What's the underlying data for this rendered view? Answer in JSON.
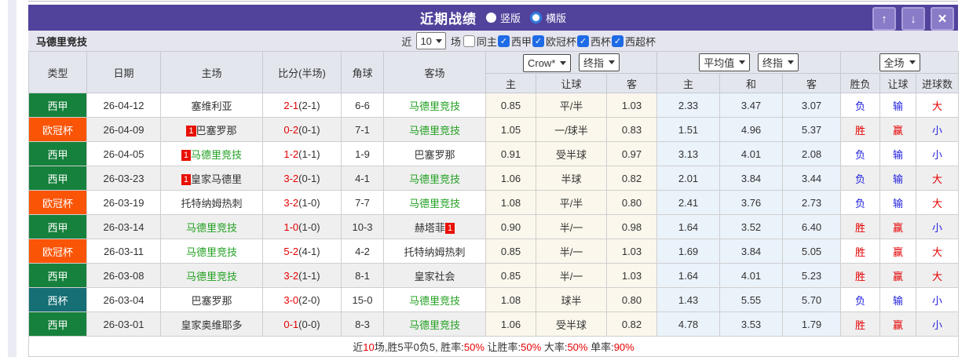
{
  "titlebar": {
    "title": "近期战绩",
    "radios": [
      {
        "label": "竖版",
        "selected": true
      },
      {
        "label": "横版",
        "selected": false
      }
    ],
    "buttons": [
      {
        "name": "move-up",
        "glyph": "↑"
      },
      {
        "name": "move-down",
        "glyph": "↓"
      },
      {
        "name": "close",
        "glyph": "×"
      }
    ]
  },
  "subheader": {
    "team": "马德里竞技",
    "near_label": "近",
    "count": "10",
    "unit": "场",
    "checkboxes": [
      {
        "label": "同主",
        "checked": false
      },
      {
        "label": "西甲",
        "checked": true
      },
      {
        "label": "欧冠杯",
        "checked": true
      },
      {
        "label": "西杯",
        "checked": true
      },
      {
        "label": "西超杯",
        "checked": true
      }
    ]
  },
  "colors": {
    "titlebar_purple": "#51429b",
    "laliga_green": "#16813c",
    "ucl_orange": "#fa5407",
    "copa_teal": "#156f75",
    "team_green": "#22a022",
    "win_red": "#e60000",
    "lose_blue": "#2121e0",
    "checkbox_blue": "#1f6be6",
    "crow_col_bg": "#fbf7ec",
    "avg_col_bg": "#eaf2fa"
  },
  "table": {
    "main_headers": [
      "类型",
      "日期",
      "主场",
      "比分(半场)",
      "角球",
      "客场"
    ],
    "group1": {
      "select1": "Crow*",
      "select2": "终指",
      "cols": [
        "主",
        "让球",
        "客"
      ]
    },
    "group2": {
      "select1": "平均值",
      "select2": "终指",
      "cols": [
        "主",
        "和",
        "客"
      ]
    },
    "group3": {
      "select": "全场",
      "cols": [
        "胜负",
        "让球",
        "进球数"
      ]
    },
    "rows": [
      {
        "type": "西甲",
        "type_color": "#16813c",
        "date": "26-04-12",
        "home": "塞维利亚",
        "home_green": false,
        "home_mark_pre": null,
        "score": "2-1",
        "half": "(2-1)",
        "corner": "6-6",
        "away": "马德里竞技",
        "away_green": true,
        "away_mark_post": null,
        "crow": [
          "0.85",
          "平/半",
          "1.03"
        ],
        "avg": [
          "2.33",
          "3.47",
          "3.07"
        ],
        "outcome": [
          {
            "text": "负",
            "color": "blue"
          },
          {
            "text": "输",
            "color": "blue"
          },
          {
            "text": "大",
            "color": "red"
          }
        ]
      },
      {
        "type": "欧冠杯",
        "type_color": "#fa5407",
        "date": "26-04-09",
        "home": "巴塞罗那",
        "home_green": false,
        "home_mark_pre": "1",
        "score": "0-2",
        "half": "(0-1)",
        "corner": "7-1",
        "away": "马德里竞技",
        "away_green": true,
        "away_mark_post": null,
        "crow": [
          "1.05",
          "一/球半",
          "0.83"
        ],
        "avg": [
          "1.51",
          "4.96",
          "5.37"
        ],
        "outcome": [
          {
            "text": "胜",
            "color": "red"
          },
          {
            "text": "赢",
            "color": "red"
          },
          {
            "text": "小",
            "color": "blue"
          }
        ]
      },
      {
        "type": "西甲",
        "type_color": "#16813c",
        "date": "26-04-05",
        "home": "马德里竞技",
        "home_green": true,
        "home_mark_pre": "1",
        "score": "1-2",
        "half": "(1-1)",
        "corner": "1-9",
        "away": "巴塞罗那",
        "away_green": false,
        "away_mark_post": null,
        "crow": [
          "0.91",
          "受半球",
          "0.97"
        ],
        "avg": [
          "3.13",
          "4.01",
          "2.08"
        ],
        "outcome": [
          {
            "text": "负",
            "color": "blue"
          },
          {
            "text": "输",
            "color": "blue"
          },
          {
            "text": "小",
            "color": "blue"
          }
        ]
      },
      {
        "type": "西甲",
        "type_color": "#16813c",
        "date": "26-03-23",
        "home": "皇家马德里",
        "home_green": false,
        "home_mark_pre": "1",
        "score": "3-2",
        "half": "(0-1)",
        "corner": "4-1",
        "away": "马德里竞技",
        "away_green": true,
        "away_mark_post": null,
        "crow": [
          "1.06",
          "半球",
          "0.82"
        ],
        "avg": [
          "2.01",
          "3.84",
          "3.44"
        ],
        "outcome": [
          {
            "text": "负",
            "color": "blue"
          },
          {
            "text": "输",
            "color": "blue"
          },
          {
            "text": "大",
            "color": "red"
          }
        ]
      },
      {
        "type": "欧冠杯",
        "type_color": "#fa5407",
        "date": "26-03-19",
        "home": "托特纳姆热刺",
        "home_green": false,
        "home_mark_pre": null,
        "score": "3-2",
        "half": "(1-0)",
        "corner": "7-7",
        "away": "马德里竞技",
        "away_green": true,
        "away_mark_post": null,
        "crow": [
          "1.08",
          "平/半",
          "0.80"
        ],
        "avg": [
          "2.41",
          "3.76",
          "2.73"
        ],
        "outcome": [
          {
            "text": "负",
            "color": "blue"
          },
          {
            "text": "输",
            "color": "blue"
          },
          {
            "text": "大",
            "color": "red"
          }
        ]
      },
      {
        "type": "西甲",
        "type_color": "#16813c",
        "date": "26-03-14",
        "home": "马德里竞技",
        "home_green": true,
        "home_mark_pre": null,
        "score": "1-0",
        "half": "(1-0)",
        "corner": "10-3",
        "away": "赫塔菲",
        "away_green": false,
        "away_mark_post": "1",
        "crow": [
          "0.90",
          "半/一",
          "0.98"
        ],
        "avg": [
          "1.64",
          "3.52",
          "6.40"
        ],
        "outcome": [
          {
            "text": "胜",
            "color": "red"
          },
          {
            "text": "赢",
            "color": "red"
          },
          {
            "text": "小",
            "color": "blue"
          }
        ]
      },
      {
        "type": "欧冠杯",
        "type_color": "#fa5407",
        "date": "26-03-11",
        "home": "马德里竞技",
        "home_green": true,
        "home_mark_pre": null,
        "score": "5-2",
        "half": "(4-1)",
        "corner": "4-2",
        "away": "托特纳姆热刺",
        "away_green": false,
        "away_mark_post": null,
        "crow": [
          "0.85",
          "半/一",
          "1.03"
        ],
        "avg": [
          "1.69",
          "3.84",
          "5.05"
        ],
        "outcome": [
          {
            "text": "胜",
            "color": "red"
          },
          {
            "text": "赢",
            "color": "red"
          },
          {
            "text": "大",
            "color": "red"
          }
        ]
      },
      {
        "type": "西甲",
        "type_color": "#16813c",
        "date": "26-03-08",
        "home": "马德里竞技",
        "home_green": true,
        "home_mark_pre": null,
        "score": "3-2",
        "half": "(1-1)",
        "corner": "8-1",
        "away": "皇家社会",
        "away_green": false,
        "away_mark_post": null,
        "crow": [
          "0.85",
          "半/一",
          "1.03"
        ],
        "avg": [
          "1.64",
          "4.01",
          "5.23"
        ],
        "outcome": [
          {
            "text": "胜",
            "color": "red"
          },
          {
            "text": "赢",
            "color": "red"
          },
          {
            "text": "大",
            "color": "red"
          }
        ]
      },
      {
        "type": "西杯",
        "type_color": "#156f75",
        "date": "26-03-04",
        "home": "巴塞罗那",
        "home_green": false,
        "home_mark_pre": null,
        "score": "3-0",
        "half": "(2-0)",
        "corner": "15-0",
        "away": "马德里竞技",
        "away_green": true,
        "away_mark_post": null,
        "crow": [
          "1.08",
          "球半",
          "0.80"
        ],
        "avg": [
          "1.43",
          "5.55",
          "5.70"
        ],
        "outcome": [
          {
            "text": "负",
            "color": "blue"
          },
          {
            "text": "输",
            "color": "blue"
          },
          {
            "text": "小",
            "color": "blue"
          }
        ]
      },
      {
        "type": "西甲",
        "type_color": "#16813c",
        "date": "26-03-01",
        "home": "皇家奥维耶多",
        "home_green": false,
        "home_mark_pre": null,
        "score": "0-1",
        "half": "(0-0)",
        "corner": "8-3",
        "away": "马德里竞技",
        "away_green": true,
        "away_mark_post": null,
        "crow": [
          "1.06",
          "受半球",
          "0.82"
        ],
        "avg": [
          "4.78",
          "3.53",
          "1.79"
        ],
        "outcome": [
          {
            "text": "胜",
            "color": "red"
          },
          {
            "text": "赢",
            "color": "red"
          },
          {
            "text": "小",
            "color": "blue"
          }
        ]
      }
    ]
  },
  "footer": {
    "parts": [
      {
        "text": "近",
        "red": false
      },
      {
        "text": "10",
        "red": true
      },
      {
        "text": "场,胜5平0负5, 胜率:",
        "red": false
      },
      {
        "text": "50%",
        "red": true
      },
      {
        "text": " 让胜率:",
        "red": false
      },
      {
        "text": "50%",
        "red": true
      },
      {
        "text": " 大率:",
        "red": false
      },
      {
        "text": "50%",
        "red": true
      },
      {
        "text": " 单率:",
        "red": false
      },
      {
        "text": "90%",
        "red": true
      }
    ]
  }
}
